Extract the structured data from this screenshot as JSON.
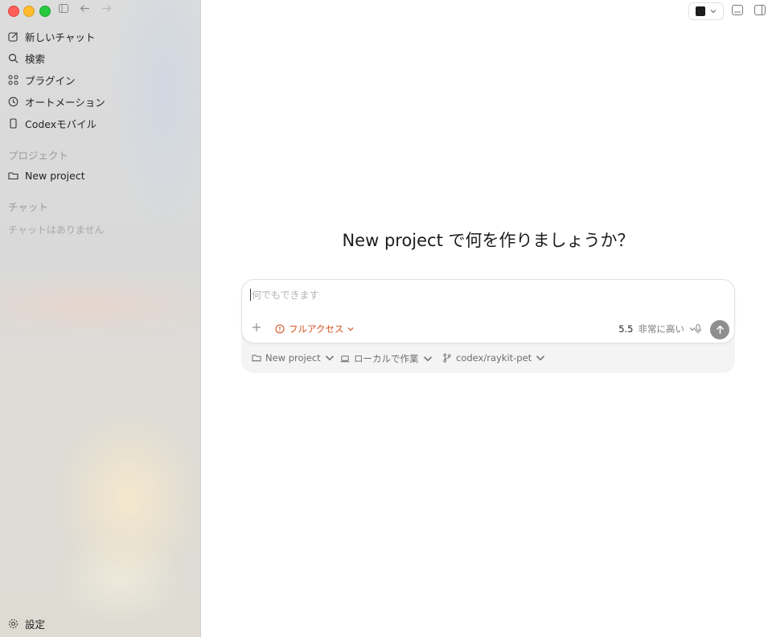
{
  "sidebar": {
    "items": [
      {
        "label": "新しいチャット",
        "icon": "edit-icon"
      },
      {
        "label": "検索",
        "icon": "search-icon"
      },
      {
        "label": "プラグイン",
        "icon": "grid-icon"
      },
      {
        "label": "オートメーション",
        "icon": "clock-icon"
      },
      {
        "label": "Codexモバイル",
        "icon": "phone-icon"
      }
    ],
    "projects_header": "プロジェクト",
    "project_item": "New project",
    "chats_header": "チャット",
    "chats_empty": "チャットはありません",
    "settings_label": "設定"
  },
  "main": {
    "heading": "New project で何を作りましょうか？",
    "composer": {
      "placeholder": "何でもできます",
      "access_label": "フルアクセス",
      "model_version": "5.5",
      "model_level": "非常に高い"
    },
    "context": {
      "project": "New project",
      "location": "ローカルで作業",
      "branch": "codex/raykit-pet"
    }
  },
  "colors": {
    "accent_orange": "#d4521f",
    "send_button": "#8e8e8e"
  }
}
